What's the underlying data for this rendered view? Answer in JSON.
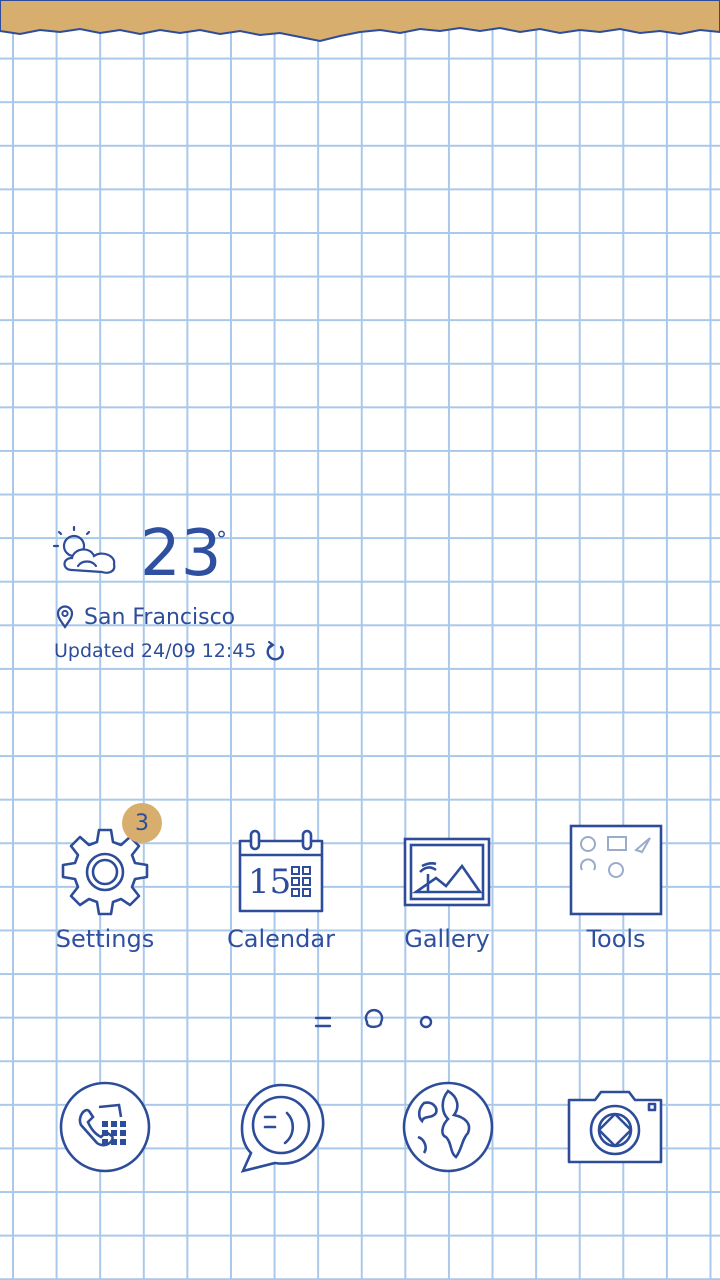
{
  "weather": {
    "temperature": "23",
    "degree_symbol": "°",
    "location": "San Francisco",
    "updated": "Updated 24/09 12:45",
    "icon": "partly-cloudy-icon"
  },
  "apps": [
    {
      "label": "Settings",
      "icon": "gear-icon",
      "badge": "3"
    },
    {
      "label": "Calendar",
      "icon": "calendar-icon",
      "date": "15"
    },
    {
      "label": "Gallery",
      "icon": "picture-icon"
    },
    {
      "label": "Tools",
      "icon": "folder-icon"
    }
  ],
  "page_indicator": {
    "pages": 3,
    "current": 1
  },
  "dock": [
    {
      "icon": "phone-icon"
    },
    {
      "icon": "message-icon"
    },
    {
      "icon": "globe-icon"
    },
    {
      "icon": "camera-icon"
    }
  ],
  "colors": {
    "ink": "#2d4d9a",
    "grid": "#a9c8ea",
    "tape": "#d8ae6e"
  }
}
